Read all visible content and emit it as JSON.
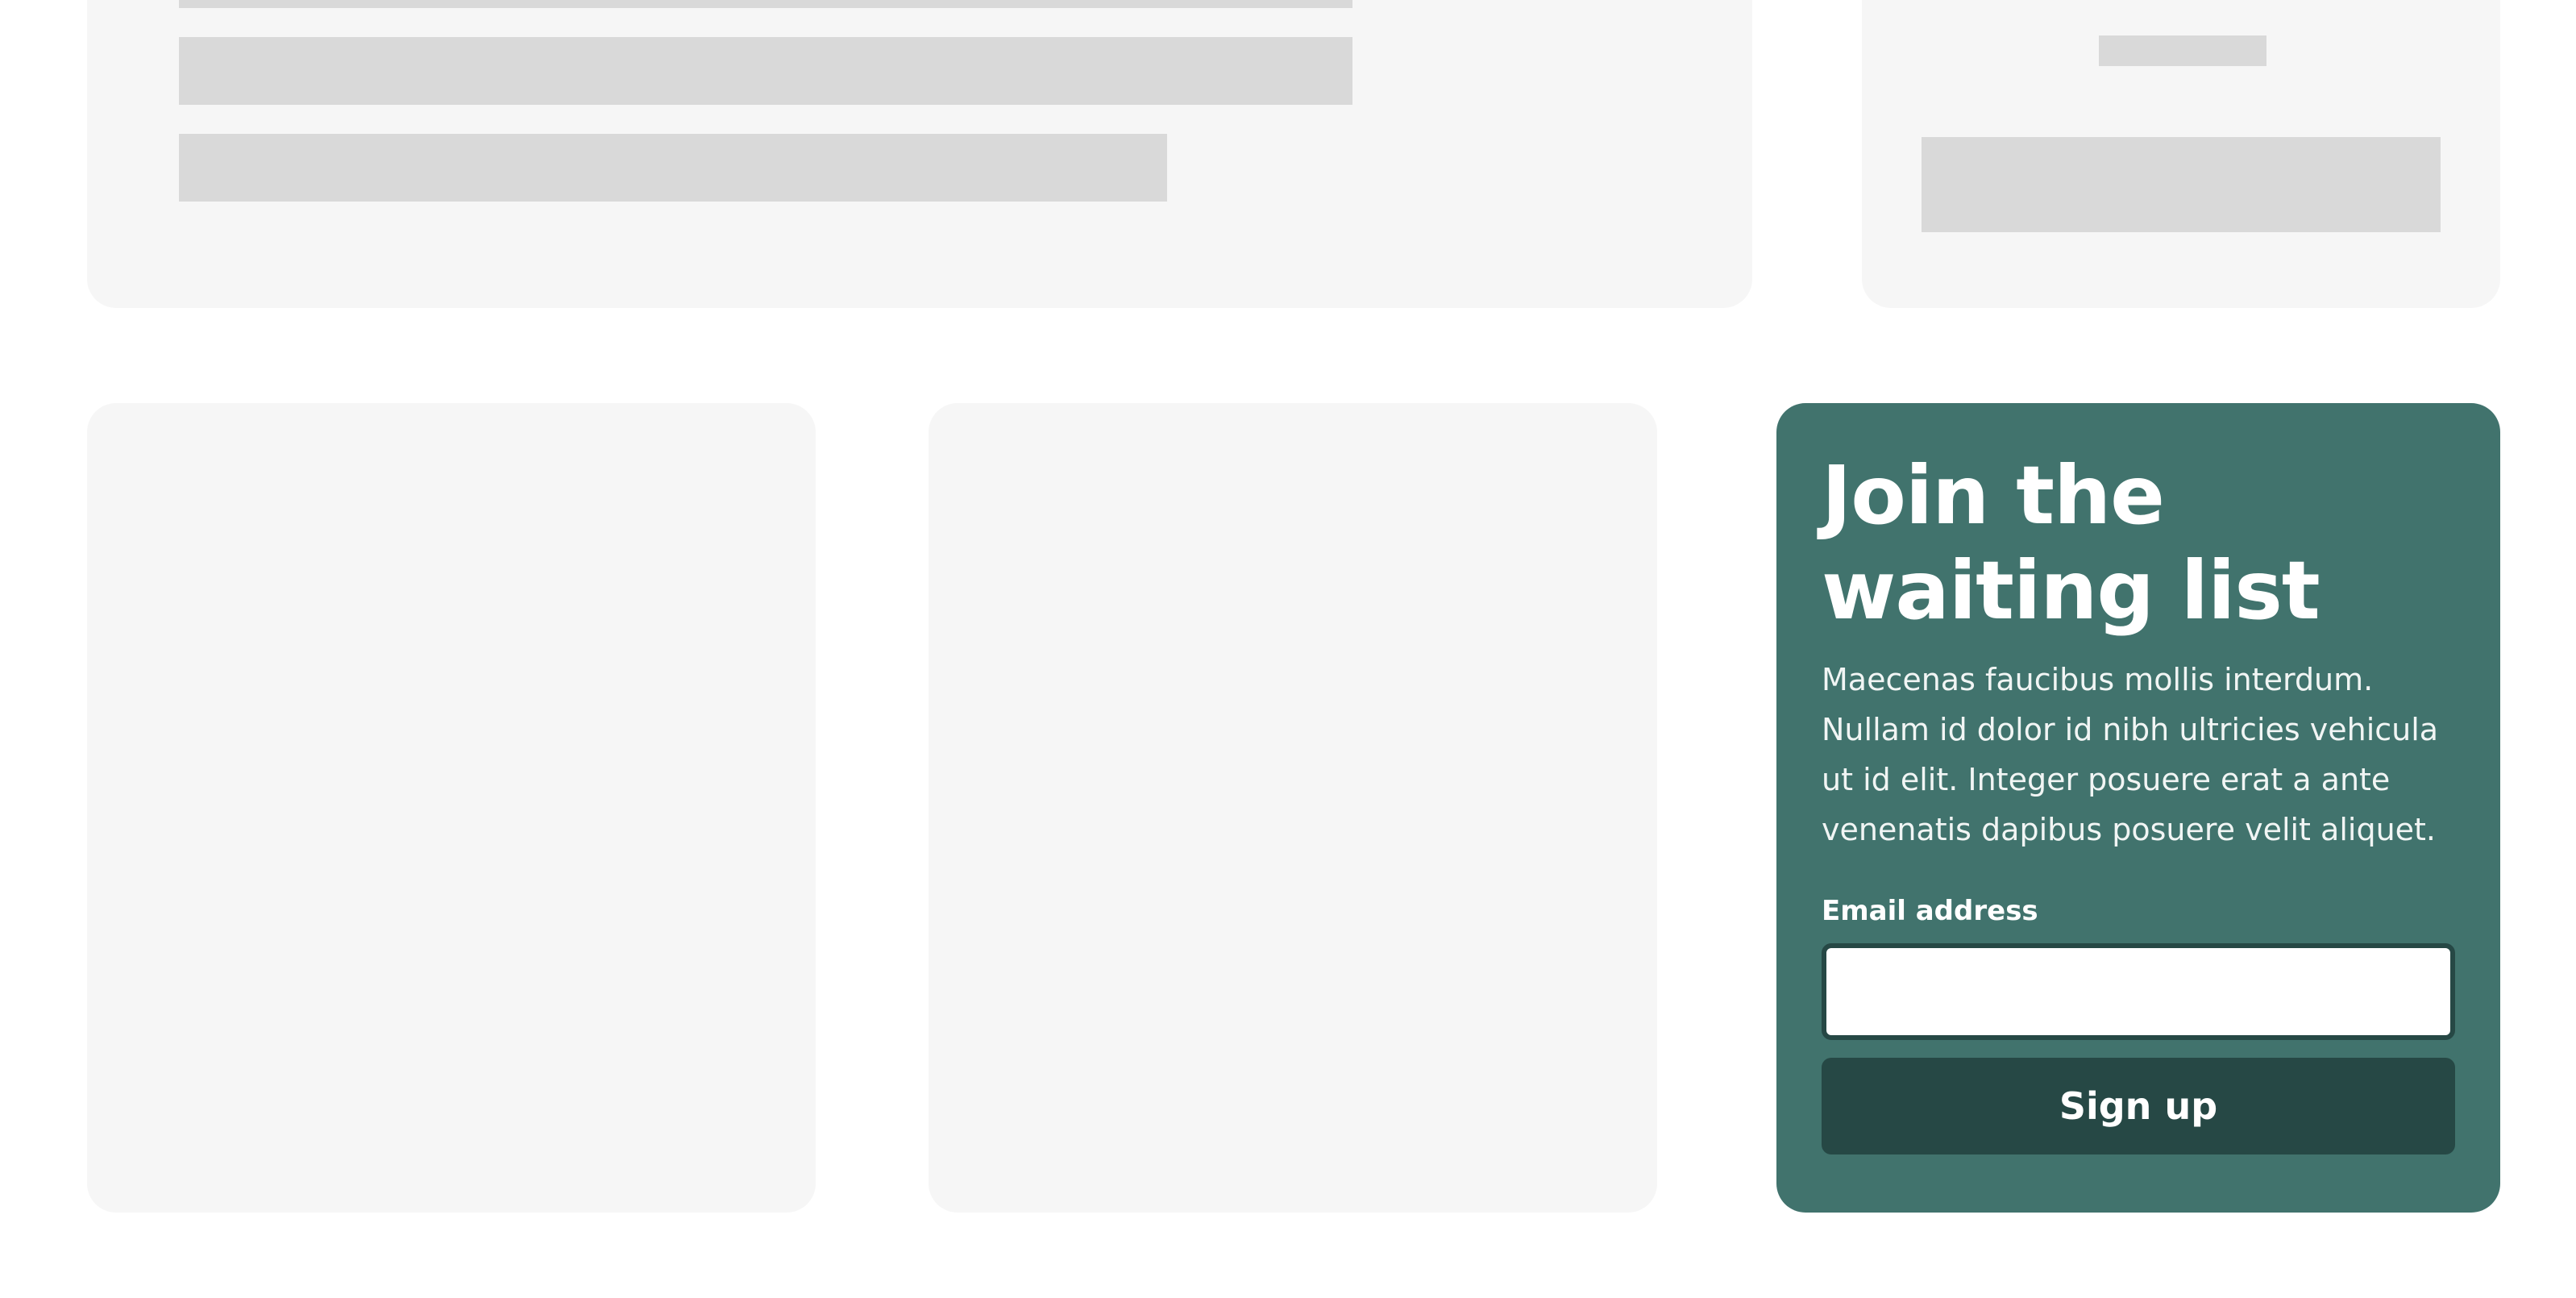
{
  "waitlist": {
    "title": "Join the waiting list",
    "description": "Maecenas faucibus mollis interdum. Nullam id dolor id nibh ultricies vehicula ut id elit. Integer posuere erat a ante venenatis dapibus posuere velit aliquet.",
    "email_label": "Email address",
    "email_value": "",
    "signup_label": "Sign up"
  },
  "colors": {
    "card_background": "#41736d",
    "button_background": "#264845",
    "placeholder_card": "#f6f6f6",
    "placeholder_bar": "#d9d9d9"
  }
}
